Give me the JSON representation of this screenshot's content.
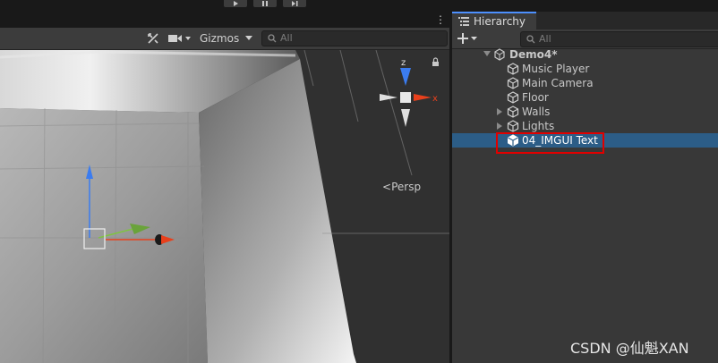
{
  "app": {
    "window": "Unity Editor"
  },
  "play_controls": [
    {
      "name": "play",
      "icon": "play-icon"
    },
    {
      "name": "pause",
      "icon": "pause-icon"
    },
    {
      "name": "step",
      "icon": "step-icon"
    }
  ],
  "scene_view": {
    "toolbar": {
      "gizmos_label": "Gizmos",
      "search_placeholder": "All",
      "tools_icon": "tools-icon",
      "camera_icon": "camera-icon"
    },
    "orientation_gizmo": {
      "z_label": "z",
      "x_label": "x",
      "projection_label": "Persp"
    }
  },
  "hierarchy": {
    "tab_label": "Hierarchy",
    "search_placeholder": "All",
    "scene_name": "Demo4*",
    "items": [
      {
        "label": "Music Player",
        "icon": "gameobject-icon",
        "has_children": false,
        "selected": false
      },
      {
        "label": "Main Camera",
        "icon": "gameobject-icon",
        "has_children": false,
        "selected": false
      },
      {
        "label": "Floor",
        "icon": "gameobject-icon",
        "has_children": false,
        "selected": false
      },
      {
        "label": "Walls",
        "icon": "gameobject-icon",
        "has_children": true,
        "selected": false
      },
      {
        "label": "Lights",
        "icon": "gameobject-icon",
        "has_children": true,
        "selected": false
      },
      {
        "label": "04_IMGUI Text",
        "icon": "gameobject-icon",
        "has_children": false,
        "selected": true
      }
    ]
  },
  "watermark": "CSDN @仙魁XAN",
  "colors": {
    "selection": "#2c5d87",
    "highlight_box": "#e00000",
    "axis_x": "#e8401c",
    "axis_y": "#7fc342",
    "axis_z": "#3b7cf0"
  }
}
